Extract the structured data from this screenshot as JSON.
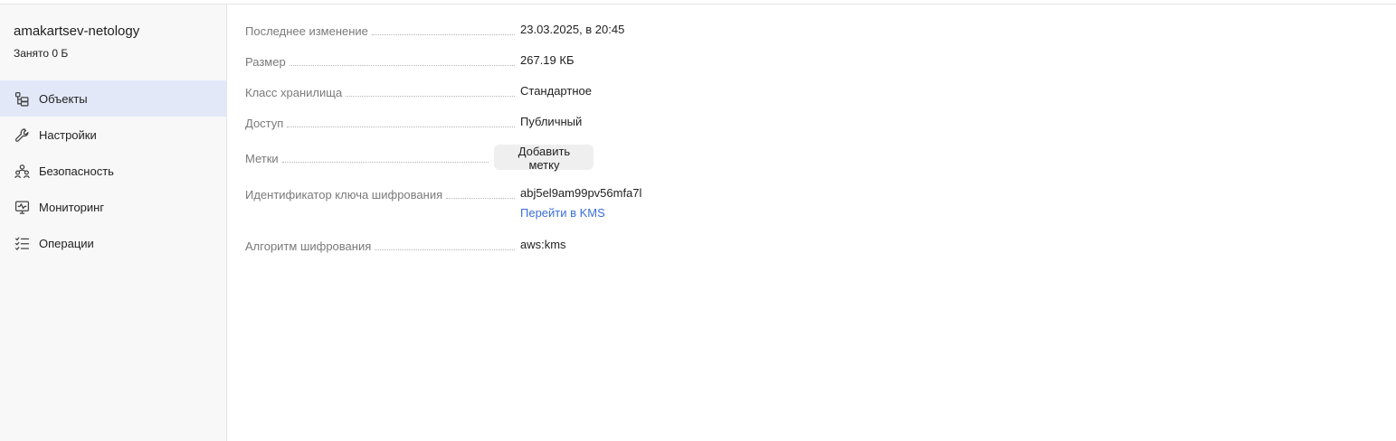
{
  "sidebar": {
    "bucket_name": "amakartsev-netology",
    "usage": "Занято 0 Б",
    "items": [
      {
        "label": "Объекты",
        "icon": "objects-tree-icon",
        "active": true
      },
      {
        "label": "Настройки",
        "icon": "wrench-icon",
        "active": false
      },
      {
        "label": "Безопасность",
        "icon": "users-group-icon",
        "active": false
      },
      {
        "label": "Мониторинг",
        "icon": "monitor-chart-icon",
        "active": false
      },
      {
        "label": "Операции",
        "icon": "checklist-icon",
        "active": false
      }
    ]
  },
  "details": {
    "last_modified": {
      "label": "Последнее изменение",
      "value": "23.03.2025, в 20:45"
    },
    "size": {
      "label": "Размер",
      "value": "267.19 КБ"
    },
    "storage_class": {
      "label": "Класс хранилища",
      "value": "Стандартное"
    },
    "access": {
      "label": "Доступ",
      "value": "Публичный"
    },
    "tags": {
      "label": "Метки",
      "button": "Добавить метку"
    },
    "encryption_key": {
      "label": "Идентификатор ключа шифрования",
      "value": "abj5el9am99pv56mfa7l",
      "link": "Перейти в KMS"
    },
    "encryption_algorithm": {
      "label": "Алгоритм шифрования",
      "value": "aws:kms"
    }
  },
  "colors": {
    "accent": "#3a6fd8",
    "active_nav_bg": "#e2e8f8",
    "sidebar_bg": "#f8f8f8"
  }
}
